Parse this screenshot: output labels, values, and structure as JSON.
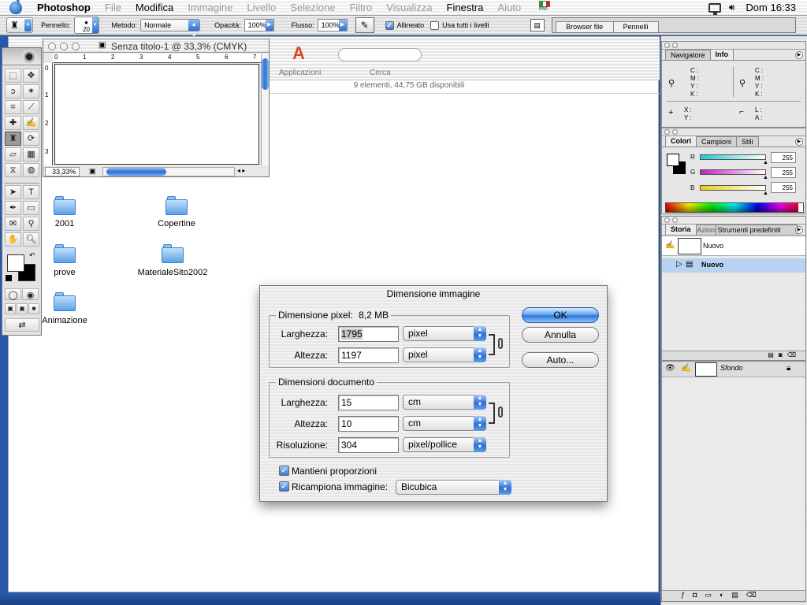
{
  "menubar": {
    "app": "Photoshop",
    "items": [
      {
        "label": "File",
        "enabled": false
      },
      {
        "label": "Modifica",
        "enabled": true
      },
      {
        "label": "Immagine",
        "enabled": false
      },
      {
        "label": "Livello",
        "enabled": false
      },
      {
        "label": "Selezione",
        "enabled": false
      },
      {
        "label": "Filtro",
        "enabled": false
      },
      {
        "label": "Visualizza",
        "enabled": false
      },
      {
        "label": "Finestra",
        "enabled": true
      },
      {
        "label": "Aiuto",
        "enabled": false
      }
    ],
    "pro_badge": "PRO",
    "clock": "Dom 16:33"
  },
  "options_bar": {
    "brush_label": "Pennello:",
    "brush_size": "20",
    "mode_label": "Metodo:",
    "mode_value": "Normale",
    "opacity_label": "Opacità:",
    "opacity_value": "100%",
    "flow_label": "Flusso:",
    "flow_value": "100%",
    "aligned_label": "Allineato",
    "aligned_checked": true,
    "use_all_layers_label": "Usa tutti i livelli",
    "use_all_layers_checked": false,
    "well_tabs": [
      "Browser file",
      "Pennelli"
    ]
  },
  "finder": {
    "toolbar": {
      "apps_label": "Applicazioni",
      "search_label": "Cerca"
    },
    "status": "9 elementi, 44,75 GB disponibili",
    "items": [
      "2001",
      "Copertine",
      "prove",
      "MaterialeSito2002",
      "Animazione"
    ]
  },
  "document": {
    "title": "Senza titolo-1 @ 33,3% (CMYK)",
    "zoom": "33,33%",
    "ruler_h": [
      "0",
      "1",
      "2",
      "3",
      "4",
      "5",
      "6",
      "7"
    ],
    "ruler_v": [
      "0",
      "1",
      "2",
      "3"
    ]
  },
  "info_panel": {
    "tabs": [
      "Navigatore",
      "Info"
    ],
    "cmyk1": [
      "C :",
      "M :",
      "Y :",
      "K :"
    ],
    "cmyk2": [
      "C :",
      "M :",
      "Y :",
      "K :"
    ],
    "xy": [
      "X :",
      "Y :"
    ],
    "la": [
      "L :",
      "A :"
    ]
  },
  "color_panel": {
    "tabs": [
      "Colori",
      "Campioni",
      "Stili"
    ],
    "channels": [
      {
        "name": "R",
        "value": "255",
        "color": "#2ec8d8"
      },
      {
        "name": "G",
        "value": "255",
        "color": "#c628c6"
      },
      {
        "name": "B",
        "value": "255",
        "color": "#e8d21a"
      }
    ]
  },
  "history_panel": {
    "tabs": [
      "Storia",
      "Azioni",
      "Strumenti predefiniti"
    ],
    "snapshot": "Nuovo",
    "states": [
      "Nuovo"
    ]
  },
  "layers_panel": {
    "layer": "Sfondo"
  },
  "dialog": {
    "title": "Dimensione immagine",
    "pixel_group": "Dimensione pixel:",
    "pixel_size": "8,2 MB",
    "width_label": "Larghezza:",
    "height_label": "Altezza:",
    "px_width": "1795",
    "px_height": "1197",
    "px_unit_w": "pixel",
    "px_unit_h": "pixel",
    "doc_group": "Dimensioni documento",
    "doc_width": "15",
    "doc_height": "10",
    "doc_unit_w": "cm",
    "doc_unit_h": "cm",
    "res_label": "Risoluzione:",
    "resolution": "304",
    "res_unit": "pixel/pollice",
    "constrain_label": "Mantieni proporzioni",
    "constrain_checked": true,
    "resample_label": "Ricampiona immagine:",
    "resample_checked": true,
    "resample_method": "Bicubica",
    "ok": "OK",
    "cancel": "Annulla",
    "auto": "Auto..."
  },
  "colors": {
    "desktop": "#2a58a8",
    "accent": "#3a78d6"
  }
}
